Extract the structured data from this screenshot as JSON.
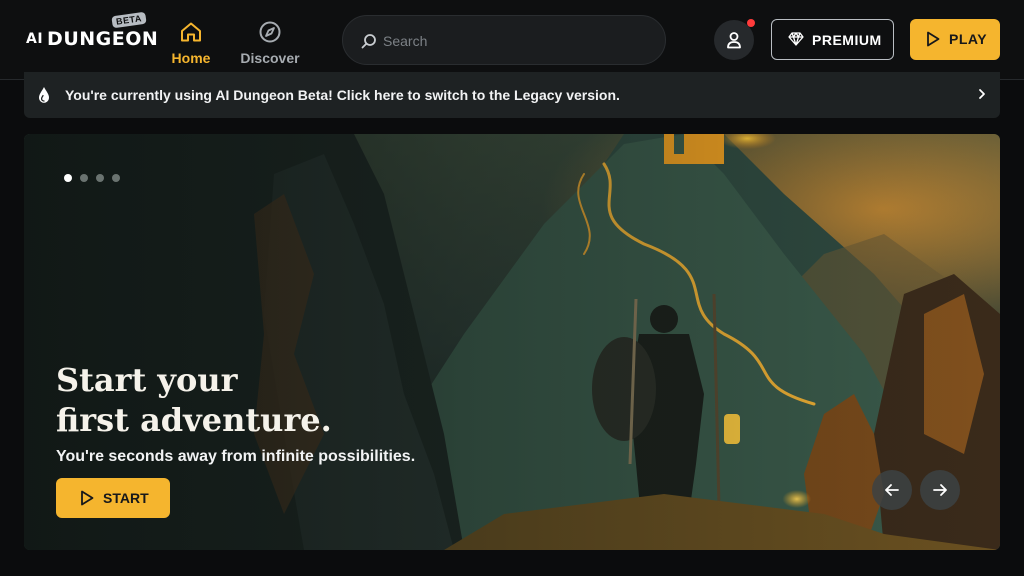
{
  "logo": {
    "prefix": "AI",
    "name": "DUNGEON",
    "badge": "BETA"
  },
  "nav": {
    "tabs": [
      {
        "label": "Home",
        "icon": "home-icon",
        "active": true
      },
      {
        "label": "Discover",
        "icon": "compass-icon",
        "active": false
      }
    ]
  },
  "search": {
    "placeholder": "Search",
    "value": ""
  },
  "header": {
    "premium_label": "PREMIUM",
    "play_label": "PLAY",
    "notification": true
  },
  "banner": {
    "text": "You're currently using AI Dungeon Beta! Click here to switch to the Legacy version."
  },
  "hero": {
    "title_line1": "Start your",
    "title_line2": "first adventure.",
    "subtitle": "You're seconds away from infinite possibilities.",
    "start_label": "START",
    "slides": 4,
    "active_slide": 0
  },
  "colors": {
    "accent": "#f5b52e",
    "background": "#0b0c0d",
    "banner": "#1e2223",
    "notification": "#ff3b3b"
  }
}
